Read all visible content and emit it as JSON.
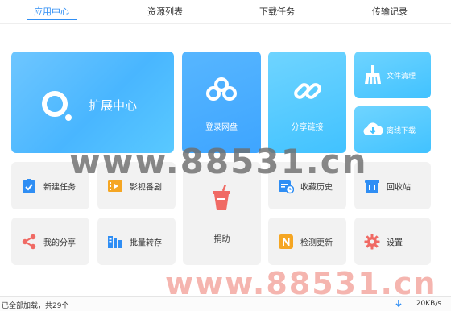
{
  "tabs": [
    {
      "label": "应用中心",
      "active": true
    },
    {
      "label": "资源列表",
      "active": false
    },
    {
      "label": "下载任务",
      "active": false
    },
    {
      "label": "传输记录",
      "active": false
    }
  ],
  "tiles": {
    "extension_center": "扩展中心",
    "login_disk": "登录网盘",
    "share_link": "分享链接",
    "file_cleanup": "文件清理",
    "offline_download": "离线下载",
    "new_task": "新建任务",
    "video_drama": "影视番剧",
    "donate": "捐助",
    "favorites_history": "收藏历史",
    "recycle_bin": "回收站",
    "my_share": "我的分享",
    "batch_transfer": "批量转存",
    "check_update": "检测更新",
    "settings": "设置"
  },
  "status": {
    "loaded_text": "已全部加载，共29个",
    "speed": "20KB/s"
  },
  "watermark": {
    "text": "www.88531.cn"
  },
  "colors": {
    "accent": "#2f8ef4",
    "tile_gray": "#f2f2f2"
  }
}
